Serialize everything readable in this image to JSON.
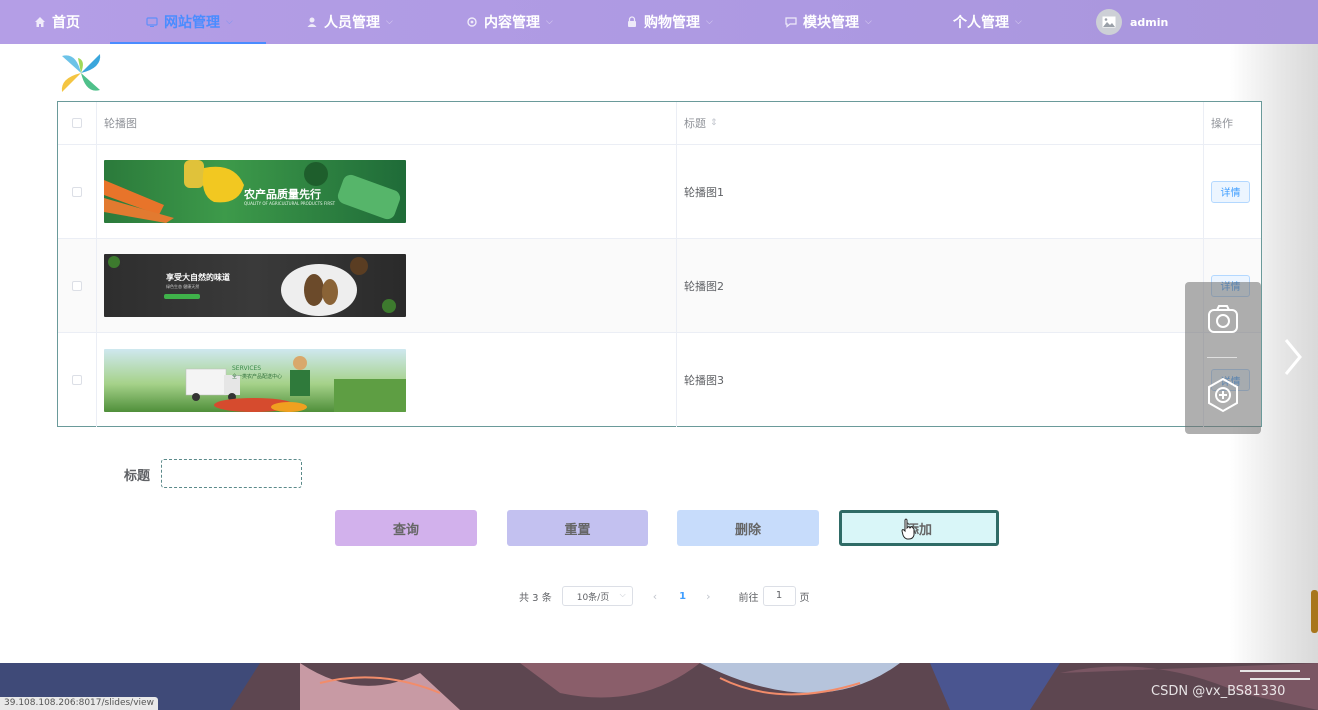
{
  "nav": {
    "items": [
      {
        "label": "首页",
        "icon": "home-icon",
        "active": false
      },
      {
        "label": "网站管理",
        "icon": "monitor-icon",
        "active": true
      },
      {
        "label": "人员管理",
        "icon": "user-icon",
        "active": false
      },
      {
        "label": "内容管理",
        "icon": "gear-icon",
        "active": false
      },
      {
        "label": "购物管理",
        "icon": "lock-icon",
        "active": false
      },
      {
        "label": "模块管理",
        "icon": "chat-icon",
        "active": false
      },
      {
        "label": "个人管理",
        "icon": "",
        "active": false
      }
    ],
    "user": "admin"
  },
  "table": {
    "headers": {
      "image": "轮播图",
      "title": "标题",
      "action": "操作"
    },
    "rows": [
      {
        "title": "轮播图1",
        "action": "详情",
        "banner": {
          "headline": "农产品质量先行",
          "sub": "QUALITY OF AGRICULTURAL PRODUCTS FIRST"
        }
      },
      {
        "title": "轮播图2",
        "action": "详情",
        "banner": {
          "headline": "享受大自然的味道",
          "sub": "绿色生态 健康天然"
        }
      },
      {
        "title": "轮播图3",
        "action": "详情",
        "banner": {
          "headline": "SERVICES",
          "sub": "全一类农产品配送中心"
        }
      }
    ]
  },
  "search": {
    "label": "标题",
    "value": "",
    "placeholder": ""
  },
  "buttons": {
    "query": "查询",
    "reset": "重置",
    "delete": "删除",
    "add": "添加"
  },
  "pager": {
    "total": "共 3 条",
    "size": "10条/页",
    "current": "1",
    "goto_prefix": "前往",
    "goto_value": "1",
    "goto_suffix": "页"
  },
  "status_url": "39.108.108.206:8017/slides/view",
  "watermark": "CSDN @vx_BS81330",
  "colors": {
    "nav": "#b49ee6",
    "active": "#4a8cff",
    "add_border": "#2f6b66"
  }
}
